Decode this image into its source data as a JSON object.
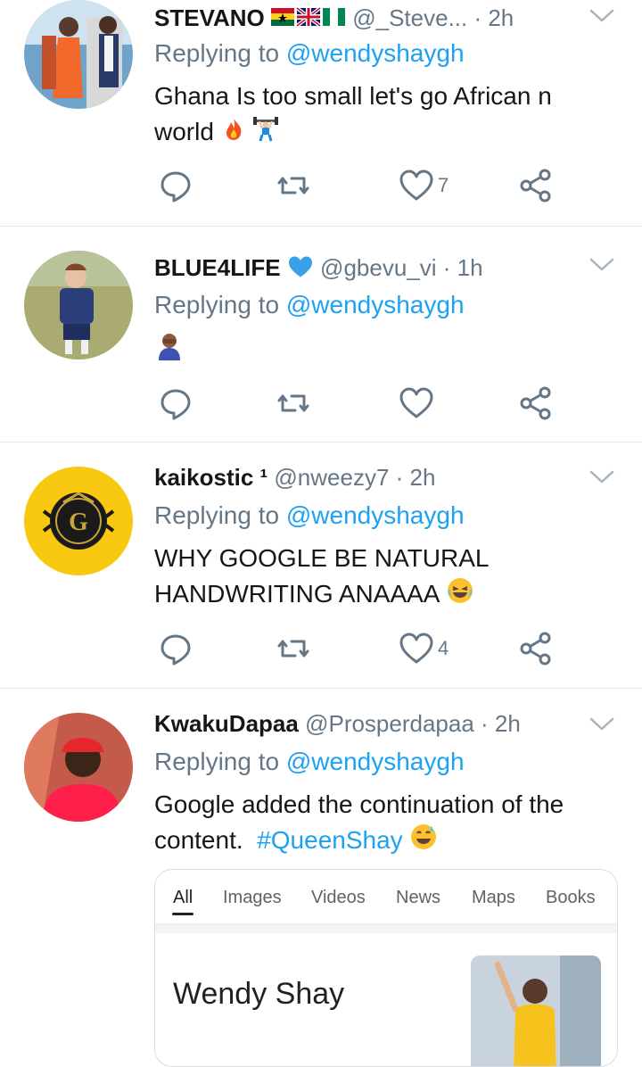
{
  "tweets": [
    {
      "display_name": "STEVANO",
      "handle_time": "@_Steve... · 2h",
      "replying_prefix": "Replying to ",
      "replying_handle": "@wendyshaygh",
      "text_line1": "Ghana Is too small let's go African n",
      "text_line2": "world",
      "likes": "7"
    },
    {
      "display_name": "BLUE4LIFE",
      "handle_time": "@gbevu_vi · 1h",
      "replying_prefix": "Replying to ",
      "replying_handle": "@wendyshaygh",
      "likes": ""
    },
    {
      "display_name": "kaikostic ¹",
      "handle_time": "@nweezy7 · 2h",
      "replying_prefix": "Replying to ",
      "replying_handle": "@wendyshaygh",
      "text_line1": "WHY GOOGLE BE NATURAL",
      "text_line2": "HANDWRITING ANAAAA",
      "likes": "4"
    },
    {
      "display_name": "KwakuDapaa",
      "handle_time": "@Prosperdapaa · 2h",
      "replying_prefix": "Replying to ",
      "replying_handle": "@wendyshaygh",
      "text_line1": "Google added the continuation of the",
      "text_line2": "content.",
      "hashtag": "#QueenShay"
    }
  ],
  "google_card": {
    "tabs": [
      "All",
      "Images",
      "Videos",
      "News",
      "Maps",
      "Books"
    ],
    "active_tab": "All",
    "result_title": "Wendy Shay"
  },
  "colors": {
    "accent": "#1da1f2",
    "muted": "#657786",
    "text": "#14171a",
    "divider": "#e1e8ed"
  },
  "icons": [
    "reply-icon",
    "retweet-icon",
    "like-icon",
    "share-icon",
    "chevron-down-icon"
  ]
}
